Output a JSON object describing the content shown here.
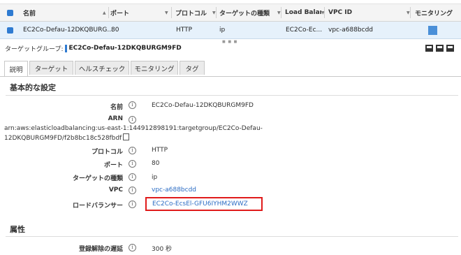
{
  "table": {
    "headers": [
      "名前",
      "ポート",
      "プロトコル",
      "ターゲットの種類",
      "Load Balanc",
      "VPC ID",
      "モニタリング"
    ],
    "row": {
      "name": "EC2Co-Defau-12DKQBURG...",
      "port": "80",
      "protocol": "HTTP",
      "target_type": "ip",
      "load_balancer": "EC2Co-Ec...",
      "vpc_id": "vpc-a688bcdd"
    }
  },
  "panel": {
    "title_label": "ターゲットグループ:",
    "title_value": "EC2Co-Defau-12DKQBURGM9FD"
  },
  "tabs": [
    "説明",
    "ターゲット",
    "ヘルスチェック",
    "モニタリング",
    "タグ"
  ],
  "basic": {
    "heading": "基本的な設定",
    "name_label": "名前",
    "name_value": "EC2Co-Defau-12DKQBURGM9FD",
    "arn_label": "ARN",
    "arn_line1": "arn:aws:elasticloadbalancing:us-east-1:144912898191:targetgroup/EC2Co-Defau-",
    "arn_line2": "12DKQBURGM9FD/f2b8bc18c528fbdf",
    "protocol_label": "プロトコル",
    "protocol_value": "HTTP",
    "port_label": "ポート",
    "port_value": "80",
    "target_type_label": "ターゲットの種類",
    "target_type_value": "ip",
    "vpc_label": "VPC",
    "vpc_value": "vpc-a688bcdd",
    "lb_label": "ロードバランサー",
    "lb_value": "EC2Co-EcsEl-GFU6IYHM2WWZ"
  },
  "attributes": {
    "heading": "属性",
    "dereg_label": "登録解除の遅延",
    "dereg_value": "300 秒"
  },
  "colors": {
    "accent": "#2f7bd1",
    "highlight": "#e01b1b",
    "link": "#2b6cc4"
  }
}
